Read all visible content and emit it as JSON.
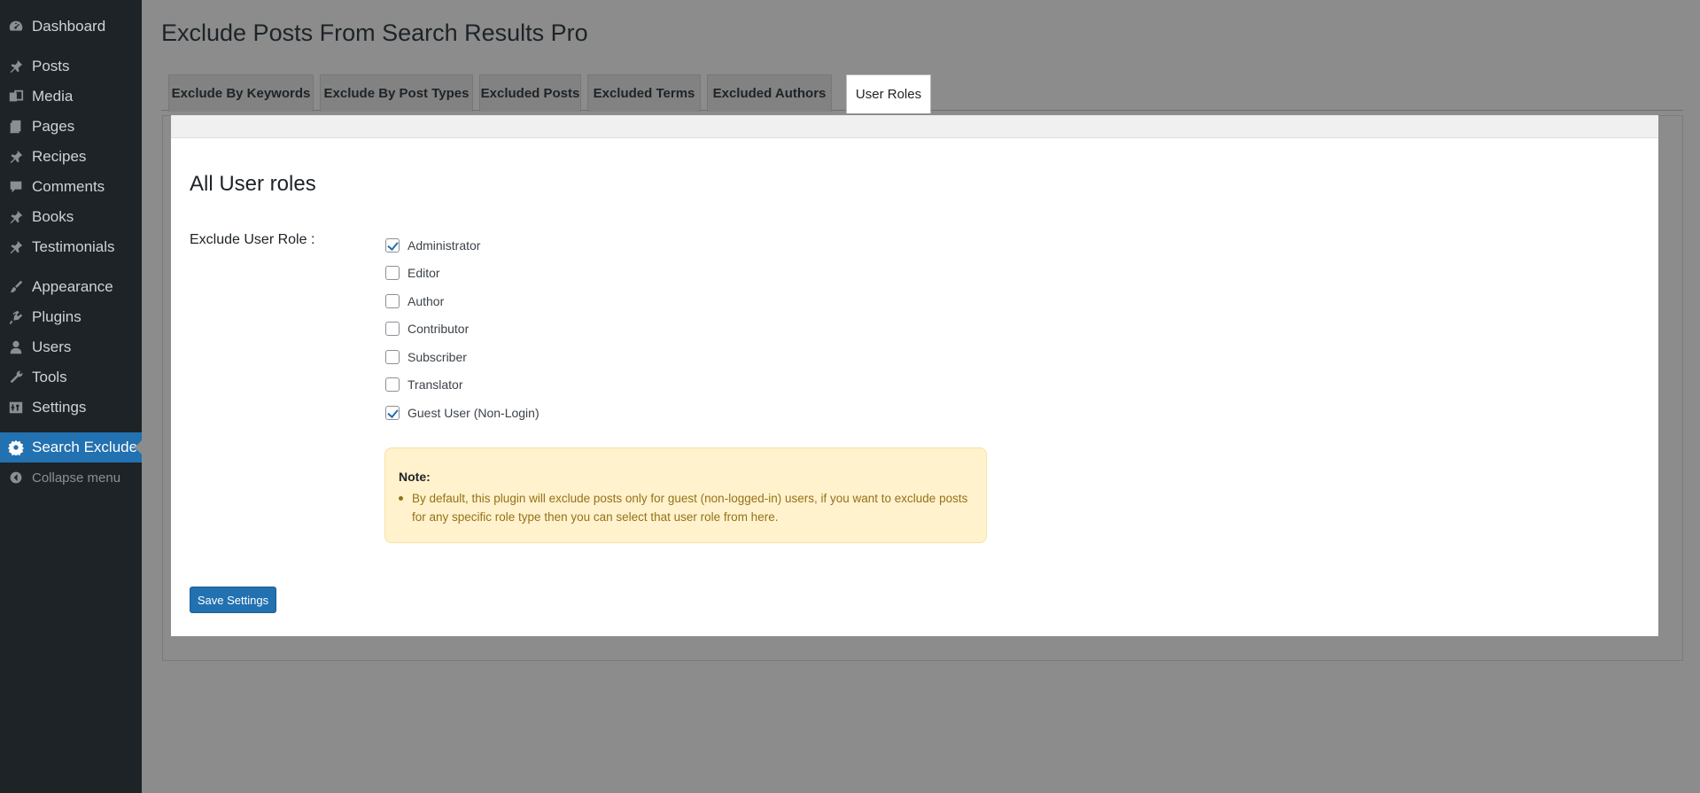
{
  "sidebar": {
    "items": [
      {
        "label": "Dashboard",
        "icon": "dashboard-icon"
      },
      {
        "label": "Posts",
        "icon": "pin-icon"
      },
      {
        "label": "Media",
        "icon": "media-icon"
      },
      {
        "label": "Pages",
        "icon": "pages-icon"
      },
      {
        "label": "Recipes",
        "icon": "pin-icon"
      },
      {
        "label": "Comments",
        "icon": "comment-icon"
      },
      {
        "label": "Books",
        "icon": "pin-icon"
      },
      {
        "label": "Testimonials",
        "icon": "pin-icon"
      },
      {
        "label": "Appearance",
        "icon": "brush-icon"
      },
      {
        "label": "Plugins",
        "icon": "plugin-icon"
      },
      {
        "label": "Users",
        "icon": "user-icon"
      },
      {
        "label": "Tools",
        "icon": "wrench-icon"
      },
      {
        "label": "Settings",
        "icon": "settings-icon"
      },
      {
        "label": "Search Exclude",
        "icon": "gear-icon",
        "active": true
      },
      {
        "label": "Collapse menu",
        "icon": "collapse-icon"
      }
    ]
  },
  "page": {
    "title": "Exclude Posts From Search Results Pro"
  },
  "tabs": [
    {
      "label": "Exclude By Keywords"
    },
    {
      "label": "Exclude By Post Types"
    },
    {
      "label": "Excluded Posts"
    },
    {
      "label": "Excluded Terms"
    },
    {
      "label": "Excluded Authors"
    },
    {
      "label": "User Roles",
      "active": true
    }
  ],
  "section": {
    "title": "All User roles",
    "field_label": "Exclude User Role :"
  },
  "roles": [
    {
      "label": "Administrator",
      "checked": true
    },
    {
      "label": "Editor",
      "checked": false
    },
    {
      "label": "Author",
      "checked": false
    },
    {
      "label": "Contributor",
      "checked": false
    },
    {
      "label": "Subscriber",
      "checked": false
    },
    {
      "label": "Translator",
      "checked": false
    },
    {
      "label": "Guest User (Non-Login)",
      "checked": true
    }
  ],
  "note": {
    "title": "Note:",
    "text": "By default, this plugin will exclude posts only for guest (non-logged-in) users, if you want to exclude posts for any specific role type then you can select that user role from here."
  },
  "actions": {
    "save_label": "Save Settings"
  },
  "colors": {
    "sidebar_bg": "#1d2327",
    "accent": "#2271b1",
    "note_bg": "#fff2cc",
    "note_text": "#94721b"
  }
}
